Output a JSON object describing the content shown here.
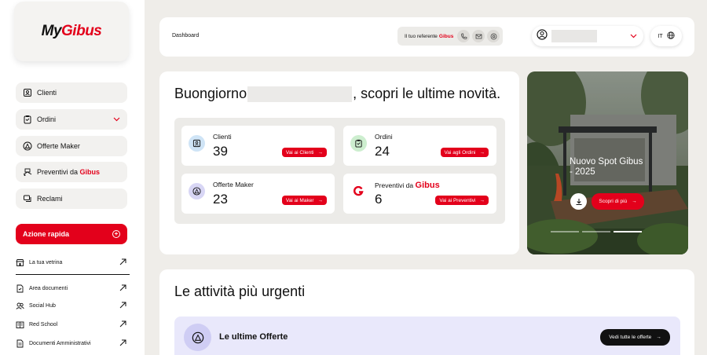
{
  "brand": {
    "logo_my": "My",
    "logo_gibus": "Gibus",
    "red": "#e3001b"
  },
  "sidebar": {
    "items": [
      {
        "label": "Clienti",
        "icon": "contact-card-icon"
      },
      {
        "label": "Ordini",
        "icon": "clipboard-icon",
        "expandable": true
      },
      {
        "label": "Offerte Maker",
        "icon": "maker-icon"
      },
      {
        "label_prefix": "Preventivi da",
        "label_brand": "Gibus",
        "icon": "blueprint-icon"
      },
      {
        "label": "Reclami",
        "icon": "chat-icon"
      }
    ],
    "quick_action": "Azione rapida",
    "vetrina": "La tua vetrina",
    "links": [
      {
        "label": "Area documenti",
        "icon": "document-icon"
      },
      {
        "label": "Social Hub",
        "icon": "people-icon"
      },
      {
        "label": "Red School",
        "icon": "book-icon"
      },
      {
        "label": "Documenti Amministrativi",
        "icon": "admin-document-icon"
      }
    ]
  },
  "topbar": {
    "breadcrumb": "Dashboard",
    "referent_label": "Il tuo referente",
    "referent_brand": "Gibus",
    "language": "IT"
  },
  "main": {
    "greeting_prefix": "Buongiorno",
    "greeting_suffix": ", scopri le ultime novità.",
    "stats": [
      {
        "label": "Clienti",
        "value": "39",
        "button": "Vai ai Clienti",
        "icon_color": "#cfe4f6"
      },
      {
        "label": "Ordini",
        "value": "24",
        "button": "Vai agli Ordini",
        "icon_color": "#cdeecf"
      },
      {
        "label": "Offerte Maker",
        "value": "23",
        "button": "Vai ai Maker",
        "icon_color": "#d8d6f5"
      },
      {
        "label_prefix": "Preventivi da",
        "label_brand": "Gibus",
        "value": "6",
        "button": "Vai ai Preventivi",
        "icon_color": "#ffffff"
      }
    ]
  },
  "promo": {
    "title": "Nuovo Spot Gibus - 2025",
    "cta": "Scopri di più",
    "active_slide": 3,
    "slide_count": 3
  },
  "urgent": {
    "title": "Le attività più urgenti",
    "card_title": "Le ultime Offerte",
    "card_button": "Vedi tutte le offerte"
  }
}
